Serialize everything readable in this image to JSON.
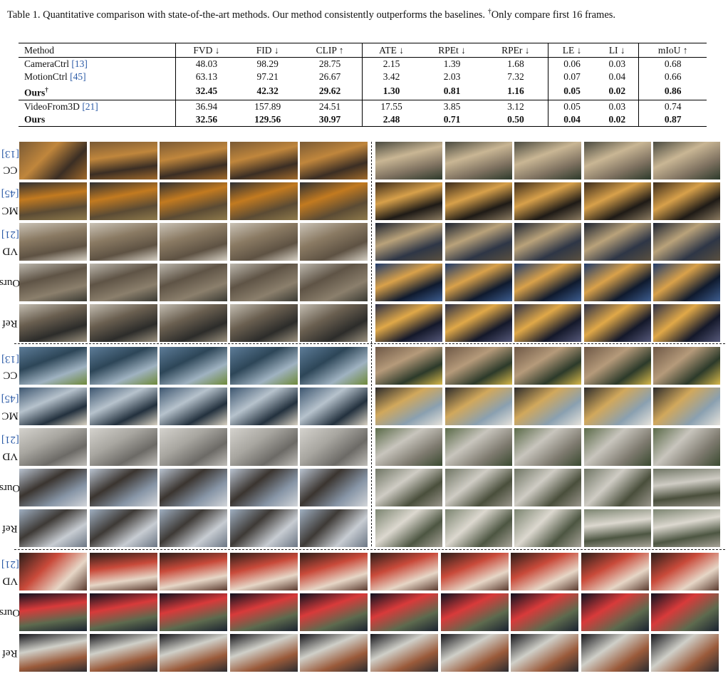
{
  "caption": {
    "label": "Table 1.",
    "text": "Quantitative comparison with state-of-the-art methods. Our method consistently outperforms the baselines.",
    "dagger": "†",
    "note": "Only compare first 16 frames."
  },
  "table": {
    "headers": [
      "Method",
      "FVD ↓",
      "FID ↓",
      "CLIP ↑",
      "ATE ↓",
      "RPEt ↓",
      "RPEr ↓",
      "LE ↓",
      "LI ↓",
      "mIoU ↑"
    ],
    "rows": [
      {
        "method": "CameraCtrl",
        "ref": "[13]",
        "values": [
          "48.03",
          "98.29",
          "28.75",
          "2.15",
          "1.39",
          "1.68",
          "0.06",
          "0.03",
          "0.68"
        ]
      },
      {
        "method": "MotionCtrl",
        "ref": "[45]",
        "values": [
          "63.13",
          "97.21",
          "26.67",
          "3.42",
          "2.03",
          "7.32",
          "0.07",
          "0.04",
          "0.66"
        ]
      },
      {
        "method": "Ours",
        "sup": "†",
        "values": [
          "32.45",
          "42.32",
          "29.62",
          "1.30",
          "0.81",
          "1.16",
          "0.05",
          "0.02",
          "0.86"
        ]
      },
      {
        "method": "VideoFrom3D",
        "ref": "[21]",
        "values": [
          "36.94",
          "157.89",
          "24.51",
          "17.55",
          "3.85",
          "3.12",
          "0.05",
          "0.03",
          "0.74"
        ]
      },
      {
        "method": "Ours",
        "values": [
          "32.56",
          "129.56",
          "30.97",
          "2.48",
          "0.71",
          "0.50",
          "0.04",
          "0.02",
          "0.87"
        ]
      }
    ]
  },
  "figure": {
    "labels": {
      "cc": {
        "text": "CC ",
        "ref": "[13]"
      },
      "mc": {
        "text": "MC ",
        "ref": "[45]"
      },
      "vd": {
        "text": "VD ",
        "ref": "[21]"
      },
      "ours": {
        "text": "Ours",
        "ref": ""
      },
      "ref": {
        "text": "Ref",
        "ref": ""
      }
    }
  }
}
